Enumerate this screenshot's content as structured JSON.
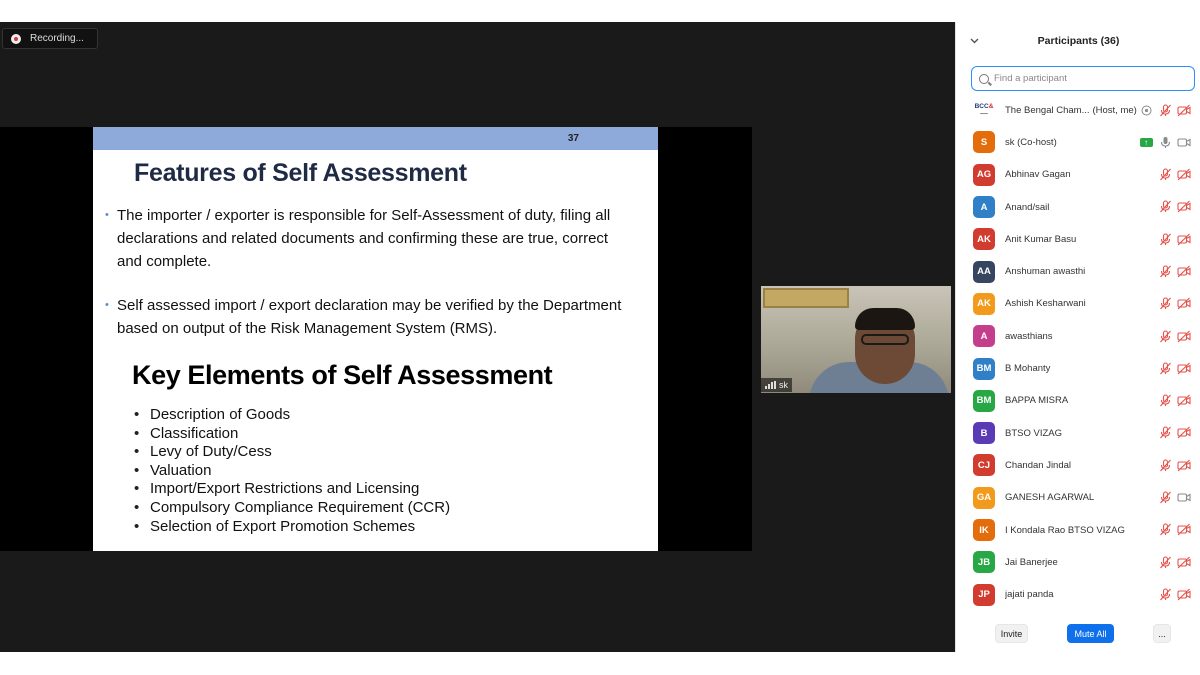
{
  "recording": {
    "label": "Recording..."
  },
  "slide": {
    "number": "37",
    "title": "Features of Self Assessment",
    "bullets": [
      "The importer / exporter is responsible for Self-Assessment of duty, filing all declarations and related documents and confirming these are true, correct and complete.",
      "Self assessed import / export declaration may be verified by the Department based on output of the Risk Management System (RMS)."
    ],
    "subtitle": "Key Elements of Self Assessment",
    "key_elements": [
      "Description of Goods",
      "Classification",
      "Levy of Duty/Cess",
      "Valuation",
      "Import/Export Restrictions and Licensing",
      "Compulsory Compliance Requirement (CCR)",
      "Selection of Export Promotion Schemes"
    ]
  },
  "video": {
    "name": "sk"
  },
  "participants_panel": {
    "title": "Participants (36)",
    "search_placeholder": "Find a participant",
    "participants": [
      {
        "initials": "BCCI",
        "name": "The Bengal Cham...",
        "role": "(Host, me)",
        "color": "#ffffff",
        "logo": true,
        "mic": "muted",
        "video": "off",
        "extra": "spotlight"
      },
      {
        "initials": "S",
        "name": "sk (Co-host)",
        "role": "",
        "color": "#e46c0a",
        "mic": "on",
        "video": "on",
        "extra": "share"
      },
      {
        "initials": "AG",
        "name": "Abhinav Gagan",
        "role": "",
        "color": "#d23c2f",
        "mic": "muted",
        "video": "off"
      },
      {
        "initials": "A",
        "name": "Anand/sail",
        "role": "",
        "color": "#2f80c6",
        "mic": "muted",
        "video": "off"
      },
      {
        "initials": "AK",
        "name": "Anit Kumar Basu",
        "role": "",
        "color": "#d23c2f",
        "mic": "muted",
        "video": "off"
      },
      {
        "initials": "AA",
        "name": "Anshuman awasthi",
        "role": "",
        "color": "#36465f",
        "mic": "muted",
        "video": "off"
      },
      {
        "initials": "AK",
        "name": "Ashish Kesharwani",
        "role": "",
        "color": "#f29a1b",
        "mic": "muted",
        "video": "off"
      },
      {
        "initials": "A",
        "name": "awasthians",
        "role": "",
        "color": "#c43e8c",
        "mic": "muted",
        "video": "off"
      },
      {
        "initials": "BM",
        "name": "B Mohanty",
        "role": "",
        "color": "#2f80c6",
        "mic": "muted",
        "video": "off"
      },
      {
        "initials": "BM",
        "name": "BAPPA MISRA",
        "role": "",
        "color": "#27a844",
        "mic": "muted",
        "video": "off"
      },
      {
        "initials": "B",
        "name": "BTSO VIZAG",
        "role": "",
        "color": "#5b3bb5",
        "mic": "muted",
        "video": "off"
      },
      {
        "initials": "CJ",
        "name": "Chandan Jindal",
        "role": "",
        "color": "#d23c2f",
        "mic": "muted",
        "video": "off"
      },
      {
        "initials": "GA",
        "name": "GANESH AGARWAL",
        "role": "",
        "color": "#f29a1b",
        "mic": "muted",
        "video": "on"
      },
      {
        "initials": "IK",
        "name": "I Kondala Rao BTSO VIZAG",
        "role": "",
        "color": "#e46c0a",
        "mic": "muted",
        "video": "off"
      },
      {
        "initials": "JB",
        "name": "Jai Banerjee",
        "role": "",
        "color": "#27a844",
        "mic": "muted",
        "video": "off"
      },
      {
        "initials": "JP",
        "name": "jajati panda",
        "role": "",
        "color": "#d23c2f",
        "mic": "muted",
        "video": "off"
      }
    ],
    "buttons": {
      "invite": "Invite",
      "mute_all": "Mute All",
      "more": "..."
    }
  },
  "colors": {
    "accent": "#0e71eb",
    "muted_icon": "#e5534b",
    "slide_bar": "#8eaadb"
  }
}
